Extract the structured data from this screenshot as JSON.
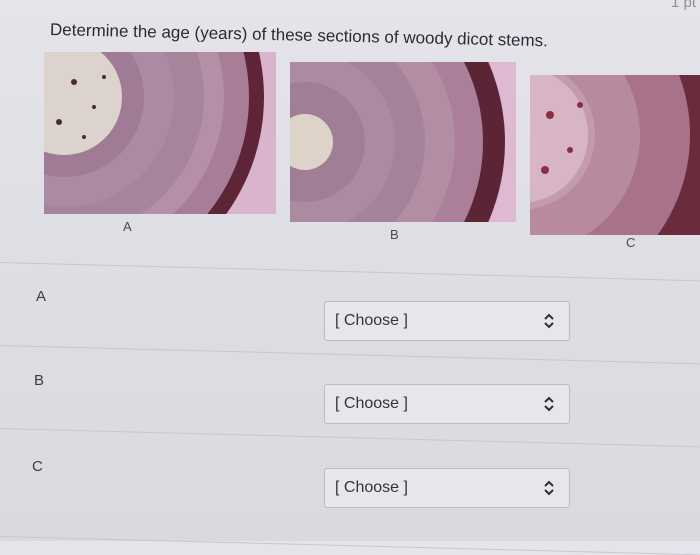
{
  "points_label": "1 pt",
  "question": "Determine the age (years) of these sections of woody dicot stems.",
  "images": [
    {
      "label": "A"
    },
    {
      "label": "B"
    },
    {
      "label": "C"
    }
  ],
  "rows": [
    {
      "label": "A",
      "select_value": "[ Choose ]"
    },
    {
      "label": "B",
      "select_value": "[ Choose ]"
    },
    {
      "label": "C",
      "select_value": "[ Choose ]"
    }
  ],
  "colors": {
    "background": "#dedfe5",
    "stain_pink": "#b78aa7",
    "bark_maroon": "#6a2c3c"
  },
  "icons": [
    "updown-chevron-icon"
  ]
}
